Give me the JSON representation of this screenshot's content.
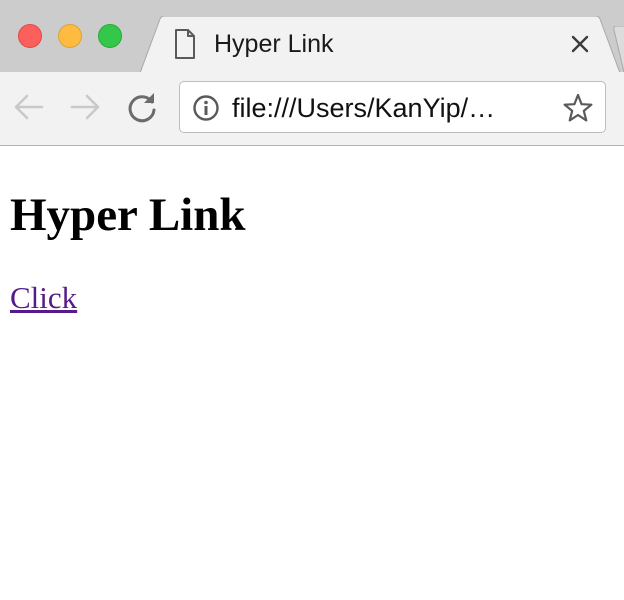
{
  "browser": {
    "tab": {
      "title": "Hyper Link"
    },
    "toolbar": {
      "url": "file:///Users/KanYip/…"
    },
    "icons": {
      "tab_icon": "document-icon",
      "tab_close": "close-icon",
      "back": "back-arrow-icon",
      "forward": "forward-arrow-icon",
      "reload": "reload-icon",
      "info": "info-icon",
      "bookmark": "star-icon"
    },
    "colors": {
      "close": "#fc605c",
      "minimize": "#fdbc40",
      "zoom": "#34c84a",
      "tabstrip": "#cccccc",
      "toolbar": "#f2f2f2"
    }
  },
  "page": {
    "heading": "Hyper Link",
    "link_text": "Click",
    "colors": {
      "visited_link": "#551a8b"
    }
  }
}
